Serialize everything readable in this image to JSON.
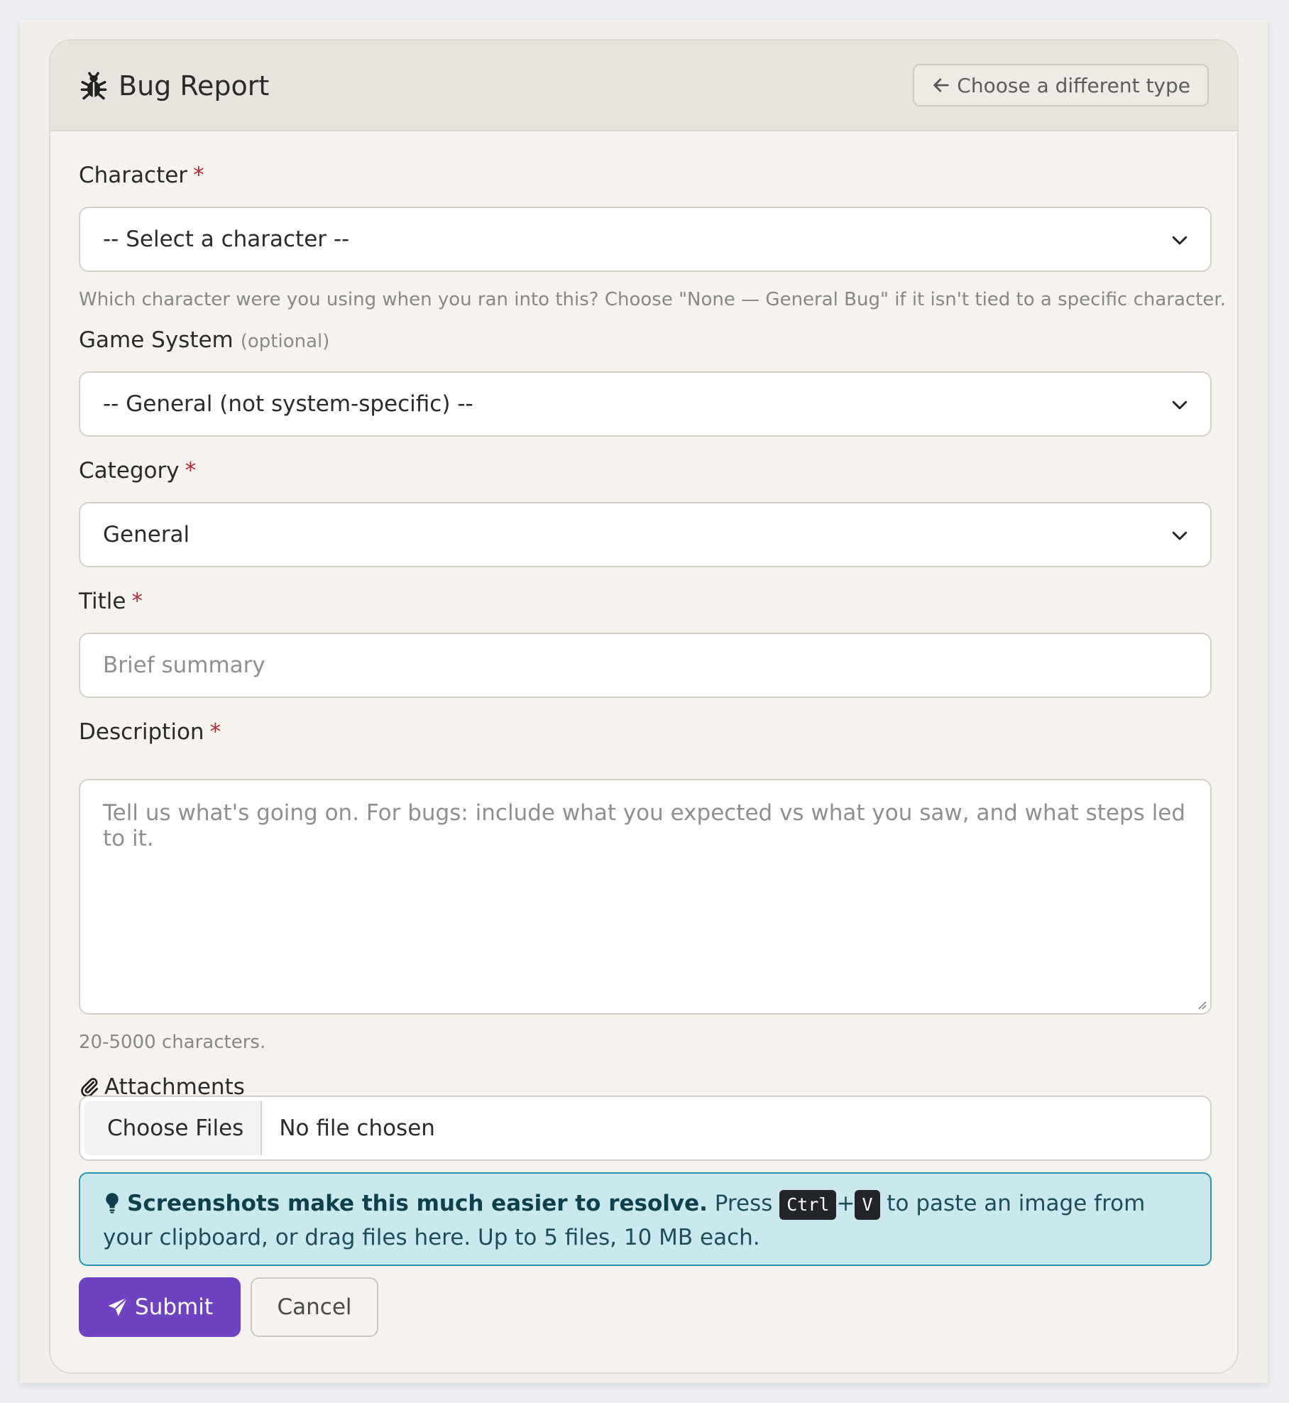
{
  "header": {
    "title": "Bug Report",
    "back_label": "Choose a different type"
  },
  "form": {
    "character": {
      "label": "Character",
      "required_mark": "*",
      "value": "-- Select a character --",
      "help": "Which character were you using when you ran into this? Choose \"None — General Bug\" if it isn't tied to a specific character."
    },
    "game_system": {
      "label": "Game System",
      "optional_note": "(optional)",
      "value": "-- General (not system-specific) --"
    },
    "category": {
      "label": "Category",
      "required_mark": "*",
      "value": "General"
    },
    "title": {
      "label": "Title",
      "required_mark": "*",
      "placeholder": "Brief summary"
    },
    "description": {
      "label": "Description",
      "required_mark": "*",
      "placeholder": "Tell us what's going on. For bugs: include what you expected vs what you saw, and what steps led to it.",
      "help": "20-5000 characters."
    },
    "attachments": {
      "label": "Attachments",
      "choose_label": "Choose Files",
      "status": "No file chosen"
    },
    "tip": {
      "strong": "Screenshots make this much easier to resolve.",
      "press": "Press",
      "key1": "Ctrl",
      "plus": "+",
      "key2": "V",
      "rest": "to paste an image from your clipboard, or drag files here. Up to 5 files, 10 MB each."
    },
    "submit_label": "Submit",
    "cancel_label": "Cancel"
  },
  "icons": {
    "header": "bug-icon",
    "back": "arrow-left-icon",
    "select": "chevron-down-icon",
    "attachments": "paperclip-icon",
    "tip": "lightbulb-icon",
    "submit": "send-icon"
  },
  "colors": {
    "primary": "#6f42c1",
    "required": "#b02a37",
    "info_bg": "#cce8ef",
    "info_border": "#2a93ad"
  }
}
